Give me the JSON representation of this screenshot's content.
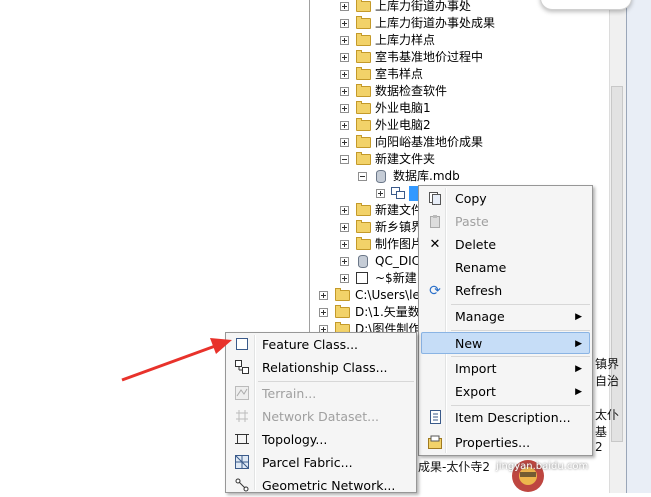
{
  "tree": {
    "items": [
      {
        "label": "上库力街道办事处"
      },
      {
        "label": "上库力街道办事处成果"
      },
      {
        "label": "上库力样点"
      },
      {
        "label": "室韦基准地价过程中"
      },
      {
        "label": "室韦样点"
      },
      {
        "label": "数据检查软件"
      },
      {
        "label": "外业电脑1"
      },
      {
        "label": "外业电脑2"
      },
      {
        "label": "向阳峪基准地价成果"
      },
      {
        "label": "新建文件夹"
      },
      {
        "label": "数据库.mdb"
      },
      {
        "label": "新建文件"
      },
      {
        "label": "新乡镇界"
      },
      {
        "label": "制作图片"
      },
      {
        "label": "QC_DIC"
      },
      {
        "label": "~$新建"
      },
      {
        "label": "C:\\Users\\le"
      },
      {
        "label": "D:\\1.矢量数"
      },
      {
        "label": "D:\\图件制作"
      }
    ]
  },
  "context_menu": {
    "items": [
      {
        "label": "Copy",
        "icon": "copy-icon"
      },
      {
        "label": "Paste",
        "icon": "paste-icon"
      },
      {
        "label": "Delete",
        "icon": "delete-icon"
      },
      {
        "label": "Rename"
      },
      {
        "label": "Refresh",
        "icon": "refresh-icon"
      },
      {
        "label": "Manage"
      },
      {
        "label": "New"
      },
      {
        "label": "Import"
      },
      {
        "label": "Export"
      },
      {
        "label": "Item Description...",
        "icon": "item-description-icon"
      },
      {
        "label": "Properties...",
        "icon": "properties-icon"
      }
    ]
  },
  "new_submenu": {
    "items": [
      {
        "label": "Feature Class...",
        "icon": "feature-class-icon"
      },
      {
        "label": "Relationship Class...",
        "icon": "relationship-class-icon"
      },
      {
        "label": "Terrain...",
        "icon": "terrain-icon"
      },
      {
        "label": "Network Dataset...",
        "icon": "network-dataset-icon"
      },
      {
        "label": "Topology...",
        "icon": "topology-icon"
      },
      {
        "label": "Parcel Fabric...",
        "icon": "parcel-fabric-icon"
      },
      {
        "label": "Geometric Network...",
        "icon": "geometric-network-icon"
      }
    ]
  },
  "background": {
    "right_text_1": "镇界",
    "right_text_2": "自治",
    "right_text_3": "太仆",
    "right_text_4": "基",
    "right_text_5": "2",
    "bottom_text": "成果-太仆寺2",
    "watermark_text": "jingyan.baidu.com"
  },
  "colors": {
    "highlight": "#c6ddf7",
    "menu_bg": "#f5f5f5",
    "folder": "#f2d269",
    "arrow": "#e8322b"
  }
}
